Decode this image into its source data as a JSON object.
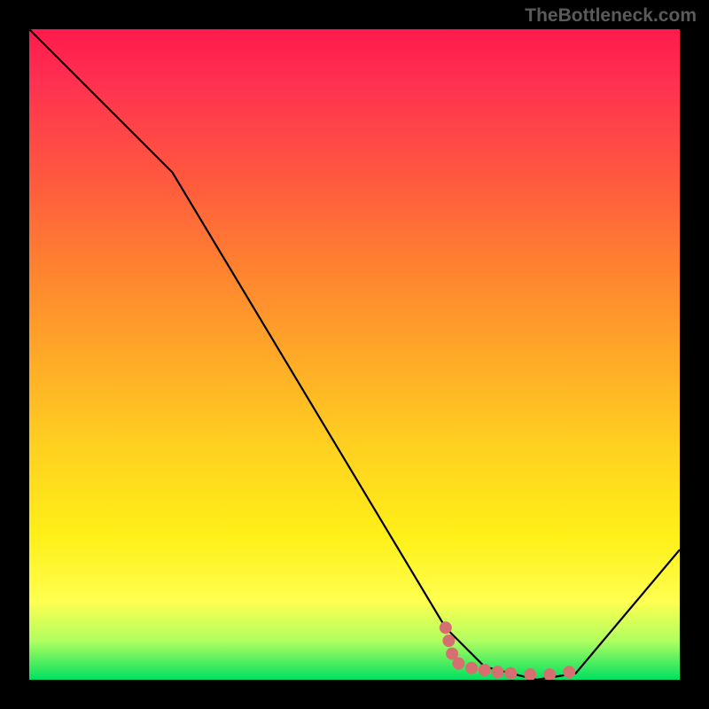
{
  "watermark": "TheBottleneck.com",
  "chart_data": {
    "type": "line",
    "title": "",
    "xlabel": "",
    "ylabel": "",
    "xlim": [
      0,
      100
    ],
    "ylim": [
      0,
      100
    ],
    "curve": [
      {
        "x": 0,
        "y": 100
      },
      {
        "x": 22,
        "y": 78
      },
      {
        "x": 64,
        "y": 8
      },
      {
        "x": 70,
        "y": 2
      },
      {
        "x": 78,
        "y": 0
      },
      {
        "x": 84,
        "y": 1
      },
      {
        "x": 100,
        "y": 20
      }
    ],
    "markers": [
      {
        "x": 64,
        "y": 8
      },
      {
        "x": 64.5,
        "y": 6
      },
      {
        "x": 65,
        "y": 4
      },
      {
        "x": 66,
        "y": 2.5
      },
      {
        "x": 68,
        "y": 1.8
      },
      {
        "x": 70,
        "y": 1.5
      },
      {
        "x": 72,
        "y": 1.2
      },
      {
        "x": 74,
        "y": 1.0
      },
      {
        "x": 77,
        "y": 0.8
      },
      {
        "x": 80,
        "y": 0.8
      },
      {
        "x": 83,
        "y": 1.2
      }
    ],
    "colors": {
      "curve": "#000000",
      "marker": "#d67070"
    }
  }
}
